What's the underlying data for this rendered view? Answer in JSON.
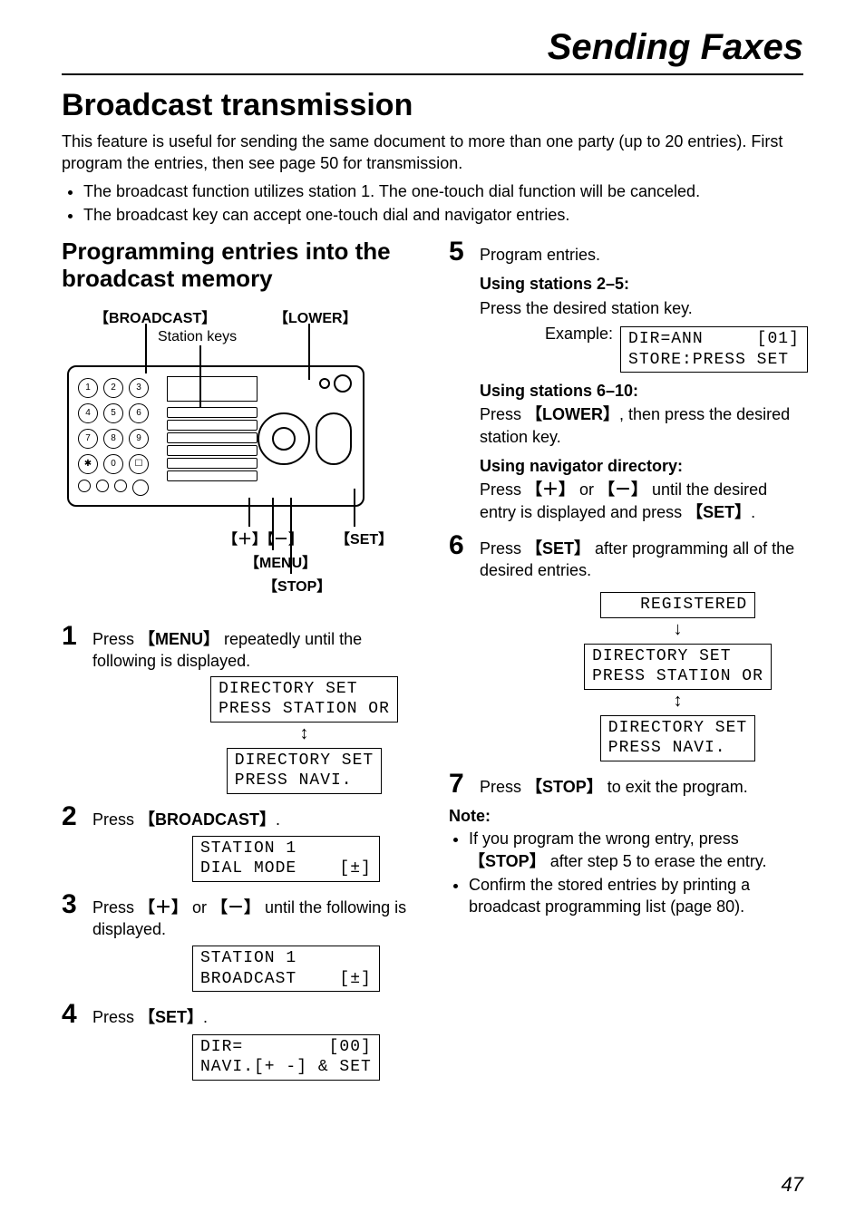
{
  "chapter_title": "Sending Faxes",
  "section_title": "Broadcast transmission",
  "intro": "This feature is useful for sending the same document to more than one party (up to 20 entries). First program the entries, then see page 50 for transmission.",
  "intro_bullets": [
    "The broadcast function utilizes station 1. The one-touch dial function will be canceled.",
    "The broadcast key can accept one-touch dial and navigator entries."
  ],
  "left": {
    "subsection_title": "Programming entries into the broadcast memory",
    "labels": {
      "broadcast": "BROADCAST",
      "lower": "LOWER",
      "station_keys": "Station keys",
      "plus": "＋",
      "minus": "－",
      "menu": "MENU",
      "stop": "STOP",
      "set": "SET"
    },
    "steps": {
      "1": {
        "pre": "Press ",
        "key": "MENU",
        "post": " repeatedly until the following is displayed.",
        "lcd1": "DIRECTORY SET\nPRESS STATION OR",
        "lcd2": "DIRECTORY SET\nPRESS NAVI."
      },
      "2": {
        "pre": "Press ",
        "key": "BROADCAST",
        "post": ".",
        "lcd": "STATION 1\nDIAL MODE    [±]"
      },
      "3": {
        "pre": "Press ",
        "key1": "＋",
        "mid": " or ",
        "key2": "－",
        "post": " until the following is displayed.",
        "lcd": "STATION 1\nBROADCAST    [±]"
      },
      "4": {
        "pre": "Press ",
        "key": "SET",
        "post": ".",
        "lcd": "DIR=        [00]\nNAVI.[+ -] & SET"
      }
    }
  },
  "right": {
    "steps": {
      "5": {
        "text": "Program entries.",
        "sub1_title": "Using stations 2–5:",
        "sub1_text": "Press the desired station key.",
        "example_label": "Example:",
        "example_lcd": "DIR=ANN     [01]\nSTORE:PRESS SET",
        "sub2_title": "Using stations 6–10:",
        "sub2_pre": "Press ",
        "sub2_key": "LOWER",
        "sub2_post": ", then press the desired station key.",
        "sub3_title": "Using navigator directory:",
        "sub3_pre": "Press ",
        "sub3_k1": "＋",
        "sub3_mid1": " or ",
        "sub3_k2": "－",
        "sub3_mid2": " until the desired entry is displayed and press ",
        "sub3_k3": "SET",
        "sub3_post": "."
      },
      "6": {
        "pre": "Press ",
        "key": "SET",
        "post": " after programming all of the desired entries.",
        "lcd1": "   REGISTERED",
        "lcd2": "DIRECTORY SET\nPRESS STATION OR",
        "lcd3": "DIRECTORY SET\nPRESS NAVI."
      },
      "7": {
        "pre": "Press ",
        "key": "STOP",
        "post": " to exit the program."
      }
    },
    "note_title": "Note:",
    "notes": {
      "0_pre": "If you program the wrong entry, press ",
      "0_key": "STOP",
      "0_post": " after step 5 to erase the entry.",
      "1": "Confirm the stored entries by printing a broadcast programming list (page 80)."
    }
  },
  "page_number": "47"
}
